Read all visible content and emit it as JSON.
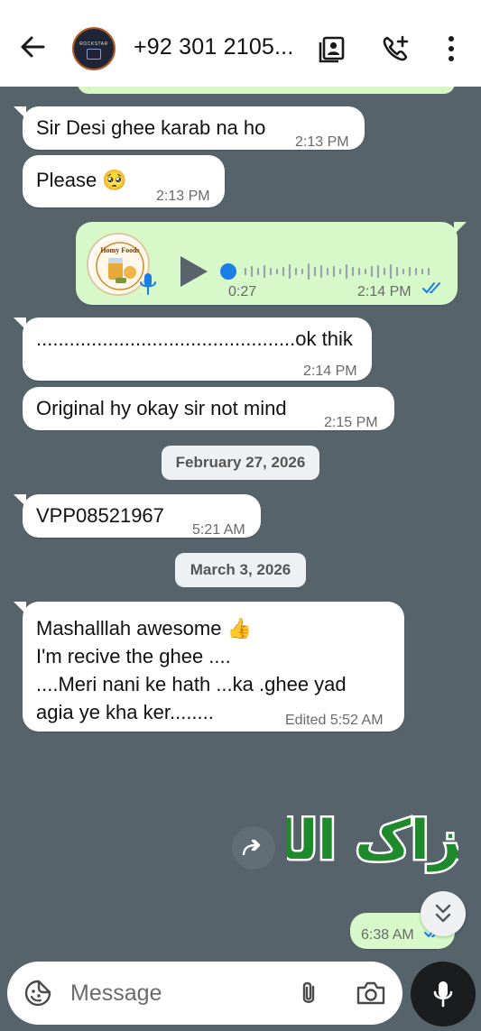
{
  "header": {
    "contact_name": "+92 301 2105...",
    "avatar_label": "ROCKSTAR"
  },
  "messages": [
    {
      "id": "m1",
      "direction": "incoming",
      "text": "Sir Desi ghee karab na ho",
      "time": "2:13 PM"
    },
    {
      "id": "m2",
      "direction": "incoming",
      "text": "Please 🥺",
      "time": "2:13 PM"
    },
    {
      "id": "m3",
      "direction": "outgoing",
      "type": "voice",
      "duration": "0:27",
      "time": "2:14 PM",
      "status": "read",
      "avatar_label": "Homy Foods"
    },
    {
      "id": "m4",
      "direction": "incoming",
      "text": "...............................................ok thik",
      "time": "2:14 PM"
    },
    {
      "id": "m5",
      "direction": "incoming",
      "text": "Original hy okay sir not mind",
      "time": "2:15 PM"
    },
    {
      "id": "m6",
      "direction": "incoming",
      "text": "VPP08521967",
      "time": "5:21 AM"
    },
    {
      "id": "m7",
      "direction": "incoming",
      "lines": [
        "Mashalllah awesome 👍",
        "I'm recive the ghee ....",
        "....Meri nani ke hath ...ka .ghee yad",
        "agia ye kha ker........"
      ],
      "time": "Edited 5:52 AM"
    },
    {
      "id": "m8",
      "direction": "outgoing",
      "type": "sticker",
      "sticker_text": "جزاک اللہ",
      "time": "6:38 AM",
      "status": "read"
    }
  ],
  "date_chips": [
    "February 27, 2026",
    "March 3, 2026"
  ],
  "composer": {
    "placeholder": "Message"
  },
  "colors": {
    "chat_background": "#56636b",
    "outgoing_bubble": "#d7f8c8",
    "incoming_bubble": "#ffffff",
    "read_tick": "#1a7ee6",
    "sticker_green": "#1f8a2b"
  },
  "icons": {
    "back": "arrow-left",
    "contacts": "contact-card",
    "add_call": "phone-plus",
    "menu": "more-vertical",
    "play": "play-triangle",
    "forward": "forward-arrows",
    "scroll_down": "chevrons-down",
    "emoji": "sticker-smile",
    "attach": "paperclip",
    "camera": "camera",
    "mic": "microphone"
  }
}
